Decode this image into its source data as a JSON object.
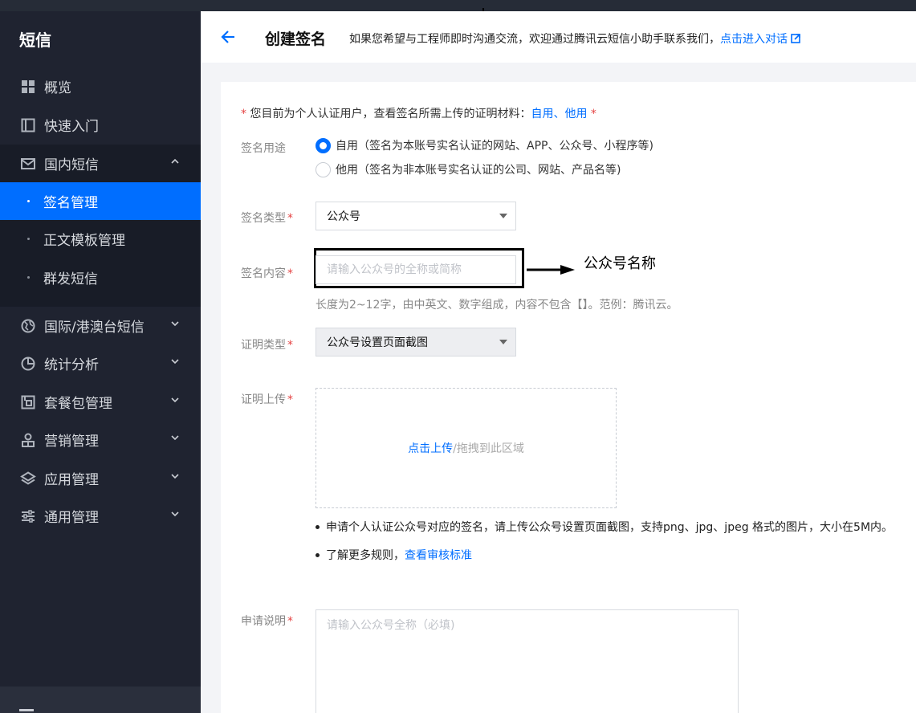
{
  "sidebar": {
    "title": "短信",
    "items": [
      {
        "label": "概览",
        "icon": "grid-icon"
      },
      {
        "label": "快速入门",
        "icon": "book-icon"
      },
      {
        "label": "国内短信",
        "icon": "mail-icon",
        "expanded": true
      },
      {
        "label": "国际/港澳台短信",
        "icon": "globe-icon"
      },
      {
        "label": "统计分析",
        "icon": "pie-chart-icon"
      },
      {
        "label": "套餐包管理",
        "icon": "package-icon"
      },
      {
        "label": "营销管理",
        "icon": "marketing-icon"
      },
      {
        "label": "应用管理",
        "icon": "layers-icon"
      },
      {
        "label": "通用管理",
        "icon": "sliders-icon"
      }
    ],
    "sub_items": [
      {
        "label": "签名管理",
        "active": true
      },
      {
        "label": "正文模板管理",
        "active": false
      },
      {
        "label": "群发短信",
        "active": false
      }
    ]
  },
  "header": {
    "title": "创建签名",
    "description": "如果您希望与工程师即时沟通交流，欢迎通过腾讯云短信小助手联系我们，",
    "link": "点击进入对话"
  },
  "form": {
    "notice": {
      "star": "*",
      "text": "您目前为个人认证用户，查看签名所需上传的证明材料：",
      "link_self": "自用",
      "sep": "、",
      "link_other": "他用",
      "star_end": "*"
    },
    "usage": {
      "label": "签名用途",
      "options": [
        {
          "label": "自用（签名为本账号实名认证的网站、APP、公众号、小程序等)",
          "checked": true
        },
        {
          "label": "他用（签名为非本账号实名认证的公司、网站、产品名等)",
          "checked": false
        }
      ]
    },
    "sign_type": {
      "label": "签名类型",
      "value": "公众号"
    },
    "sign_content": {
      "label": "签名内容",
      "placeholder": "请输入公众号的全称或简称",
      "hint": "长度为2~12字，由中英文、数字组成，内容不包含【】。范例：腾讯云。"
    },
    "annotation": "公众号名称",
    "proof_type": {
      "label": "证明类型",
      "value": "公众号设置页面截图"
    },
    "proof_upload": {
      "label": "证明上传",
      "upload_link": "点击上传",
      "upload_text": "/拖拽到此区域"
    },
    "bullets": {
      "first": "申请个人认证公众号对应的签名，请上传公众号设置页面截图，支持png、jpg、jpeg 格式的图片，大小在5M内。",
      "second_text": "了解更多规则，",
      "second_link": "查看审核标准"
    },
    "remark": {
      "label": "申请说明",
      "placeholder": "请输入公众号全称（必填)"
    },
    "required_mark": "*"
  },
  "colors": {
    "accent": "#006eff",
    "sidebar_bg": "#1f2330",
    "required": "#e54545"
  }
}
